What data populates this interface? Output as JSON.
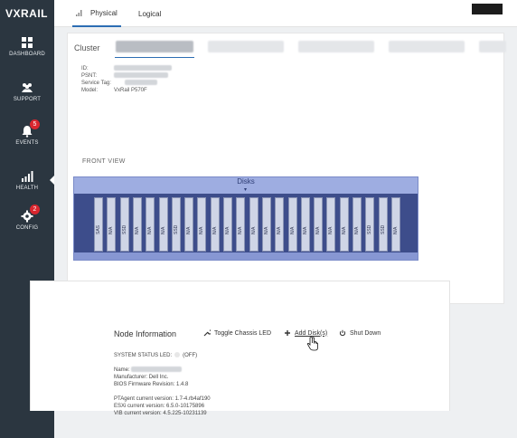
{
  "app": {
    "logo": "VXRAIL"
  },
  "sidebar": {
    "items": [
      {
        "label": "DASHBOARD",
        "icon": "grid-icon"
      },
      {
        "label": "SUPPORT",
        "icon": "people-icon"
      },
      {
        "label": "EVENTS",
        "icon": "bell-icon",
        "badge": "5"
      },
      {
        "label": "HEALTH",
        "icon": "bar-chart-icon",
        "active": true
      },
      {
        "label": "CONFIG",
        "icon": "gear-icon",
        "badge": "2"
      }
    ]
  },
  "tabs": {
    "physical": "Physical",
    "logical": "Logical",
    "active": "Physical"
  },
  "cluster": {
    "label": "Cluster"
  },
  "host": {
    "id_label": "ID:",
    "psnt_label": "PSNT:",
    "service_tag_label": "Service Tag:",
    "model_label": "Model:",
    "model_value": "VxRail P570F"
  },
  "front_view": {
    "label": "FRONT VIEW",
    "disks_label": "Disks"
  },
  "slots": [
    "SAS",
    "N/A",
    "SSD",
    "N/A",
    "N/A",
    "N/A",
    "SSD",
    "N/A",
    "N/A",
    "N/A",
    "N/A",
    "N/A",
    "N/A",
    "N/A",
    "N/A",
    "N/A",
    "N/A",
    "N/A",
    "N/A",
    "N/A",
    "N/A",
    "SSD",
    "SSD",
    "N/A"
  ],
  "node": {
    "heading": "Node Information",
    "toggle_led": "Toggle Chassis LED",
    "add_disks": "Add Disk(s)",
    "shut_down": "Shut Down",
    "status_led_label": "SYSTEM STATUS LED:",
    "status_led_value": "(OFF)",
    "name_label": "Name:",
    "manufacturer_label": "Manufacturer:",
    "manufacturer_value": "Dell Inc.",
    "bios_label": "BIOS Firmware Revision:",
    "bios_value": "1.4.8",
    "ptagent_label": "PTAgent current version:",
    "ptagent_value": "1.7-4.rb4af190",
    "esxi_label": "ESXi current version:",
    "esxi_value": "6.5.0-10175896",
    "vib_label": "VIB current version:",
    "vib_value": "4.5.225-10231139"
  },
  "colors": {
    "sidebar": "#2b3640",
    "chassis": "#3d4d8b",
    "chassis_top": "#a9b8ea",
    "badge": "#d9262e",
    "accent": "#2c6db3"
  }
}
